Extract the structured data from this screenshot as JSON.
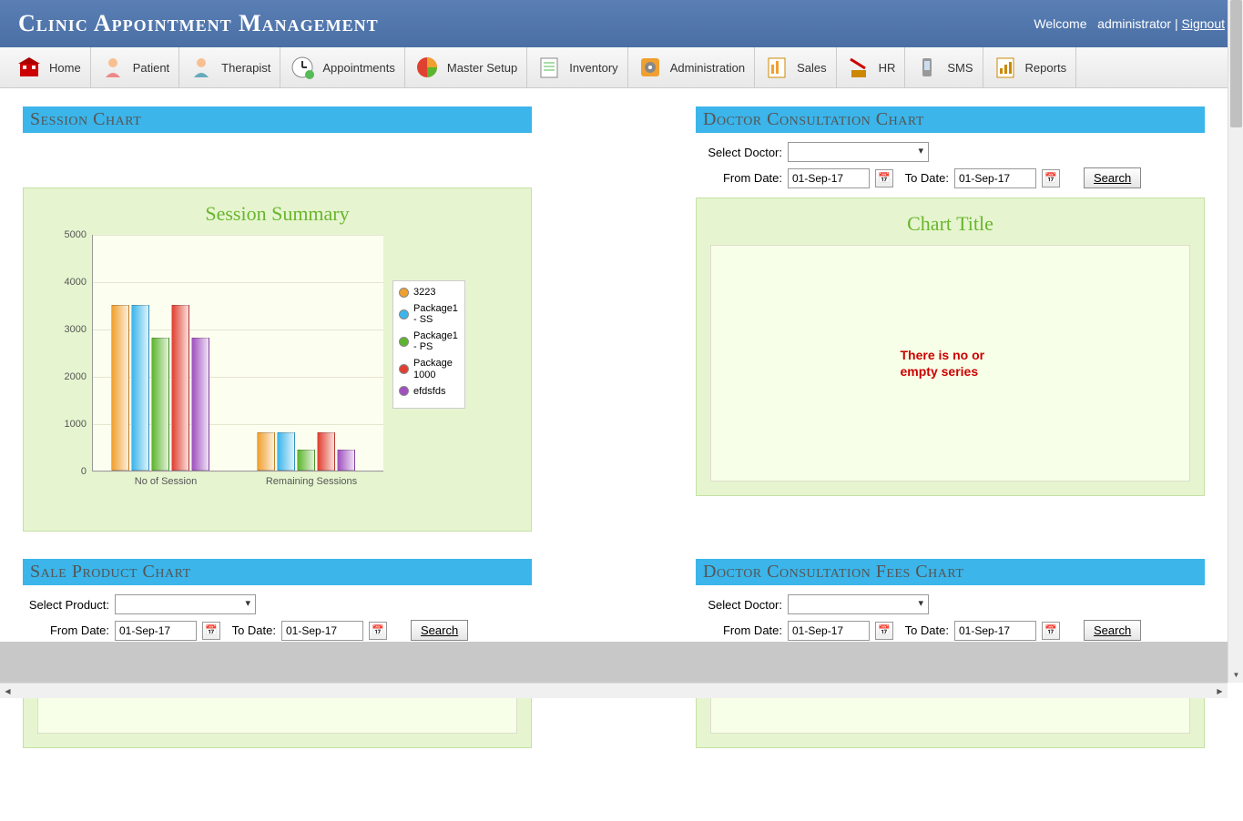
{
  "header": {
    "title": "Clinic Appointment Management",
    "welcome": "Welcome",
    "user": "administrator",
    "signout": "Signout"
  },
  "toolbar": {
    "home": "Home",
    "patient": "Patient",
    "therapist": "Therapist",
    "appointments": "Appointments",
    "master_setup": "Master Setup",
    "inventory": "Inventory",
    "administration": "Administration",
    "sales": "Sales",
    "hr": "HR",
    "sms": "SMS",
    "reports": "Reports"
  },
  "panels": {
    "session": {
      "title": "Session Chart"
    },
    "doctor_consult": {
      "title": "Doctor Consultation Chart"
    },
    "sale_product": {
      "title": "Sale Product Chart"
    },
    "doctor_fees": {
      "title": "Doctor Consultation Fees Chart"
    }
  },
  "labels": {
    "select_doctor": "Select Doctor:",
    "select_product": "Select Product:",
    "from_date": "From Date:",
    "to_date": "To Date:",
    "search": "Search"
  },
  "dates": {
    "from": "01-Sep-17",
    "to": "01-Sep-17"
  },
  "chart_placeholder_title": "Chart Title",
  "empty_series_msg": "There is no or empty series",
  "session_summary_title": "Session Summary",
  "chart_data": {
    "type": "bar",
    "title": "Session Summary",
    "ylim": [
      0,
      5000
    ],
    "yticks": [
      0,
      1000,
      2000,
      3000,
      4000,
      5000
    ],
    "categories": [
      "No of Session",
      "Remaining Sessions"
    ],
    "series": [
      {
        "name": "3223",
        "color": "#f0a030",
        "values": [
          3500,
          800
        ]
      },
      {
        "name": "Package1 - SS",
        "color": "#3bb5ea",
        "values": [
          3500,
          800
        ]
      },
      {
        "name": "Package1 - PS",
        "color": "#5cb52e",
        "values": [
          2800,
          450
        ]
      },
      {
        "name": "Package 1000",
        "color": "#e04030",
        "values": [
          3500,
          800
        ]
      },
      {
        "name": "efdsfds",
        "color": "#a050c0",
        "values": [
          2800,
          450
        ]
      }
    ]
  }
}
